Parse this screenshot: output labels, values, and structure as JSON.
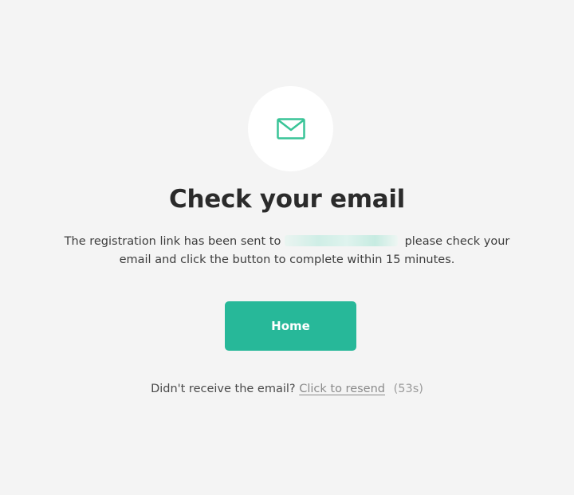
{
  "page": {
    "title": "Check your email",
    "message_before": "The registration link has been sent to",
    "message_after": "please check your email and click the button to complete within 15 minutes.",
    "home_button_label": "Home",
    "resend_prompt": "Didn't receive the email?",
    "resend_link_label": "Click to resend",
    "countdown": "(53s)"
  },
  "icons": {
    "mail": "envelope-icon"
  },
  "colors": {
    "background": "#f4f4f4",
    "accent": "#27b899",
    "icon_accent": "#39c497",
    "title": "#2b2b2b"
  }
}
